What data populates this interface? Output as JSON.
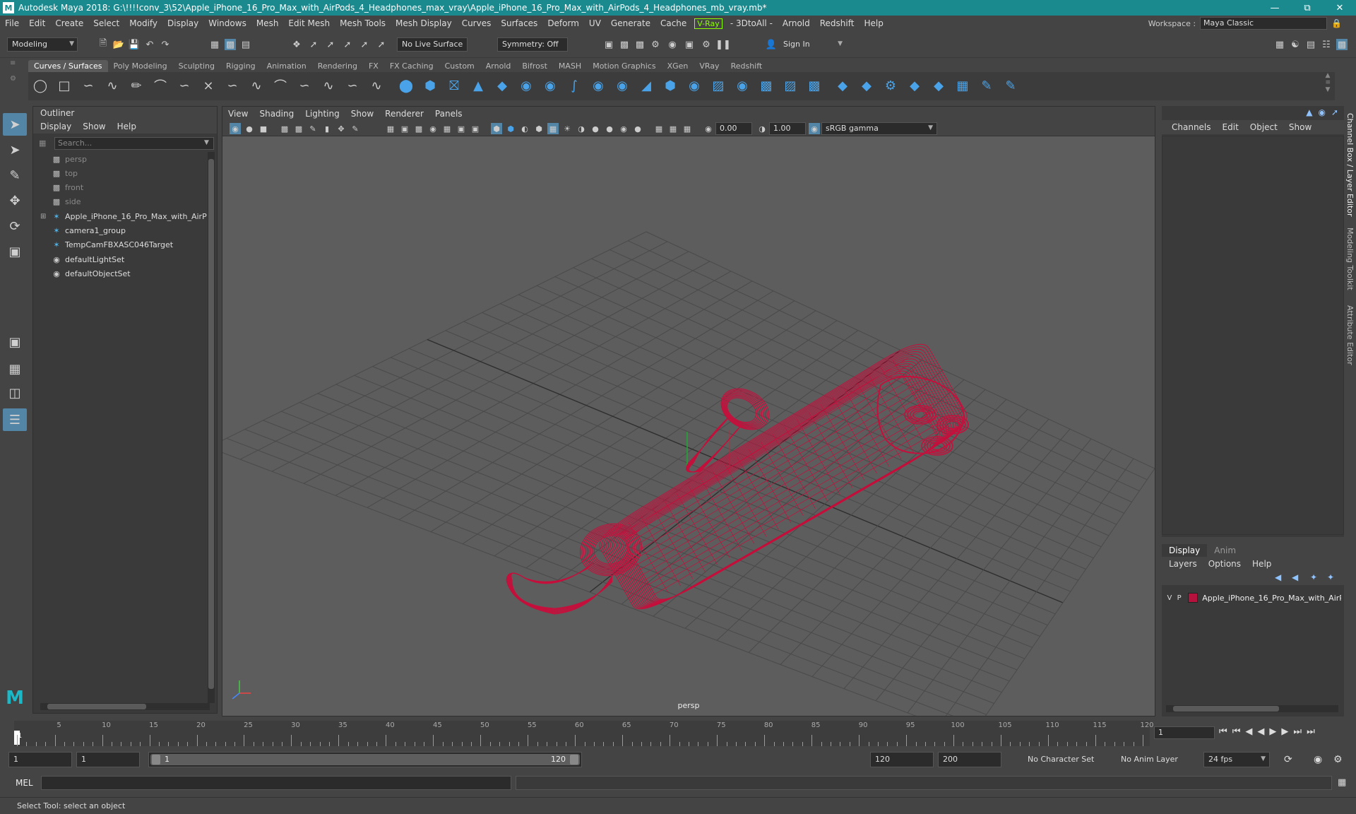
{
  "window": {
    "title": "Autodesk Maya 2018: G:\\!!!!conv_3\\52\\Apple_iPhone_16_Pro_Max_with_AirPods_4_Headphones_max_vray\\Apple_iPhone_16_Pro_Max_with_AirPods_4_Headphones_mb_vray.mb*",
    "logo": "M",
    "controls": [
      "minimize-icon",
      "restore-icon",
      "close-icon"
    ]
  },
  "menubar": {
    "items": [
      "File",
      "Edit",
      "Create",
      "Select",
      "Modify",
      "Display",
      "Windows",
      "Mesh",
      "Edit Mesh",
      "Mesh Tools",
      "Mesh Display",
      "Curves",
      "Surfaces",
      "Deform",
      "UV",
      "Generate",
      "Cache",
      "V-Ray",
      "- 3DtoAll -",
      "Arnold",
      "Redshift",
      "Help"
    ],
    "workspace_label": "Workspace :",
    "workspace_value": "Maya Classic"
  },
  "statusline": {
    "mode": "Modeling",
    "live_surface": "No Live Surface",
    "symmetry": "Symmetry: Off",
    "sign_in": "Sign In"
  },
  "shelf": {
    "tabs": [
      "Curves / Surfaces",
      "Poly Modeling",
      "Sculpting",
      "Rigging",
      "Animation",
      "Rendering",
      "FX",
      "FX Caching",
      "Custom",
      "Arnold",
      "Bifrost",
      "MASH",
      "Motion Graphics",
      "XGen",
      "VRay",
      "Redshift"
    ],
    "active_tab": "Curves / Surfaces"
  },
  "outliner": {
    "title": "Outliner",
    "menus": [
      "Display",
      "Show",
      "Help"
    ],
    "search_placeholder": "Search...",
    "items": [
      {
        "label": "persp",
        "icon": "camera-icon",
        "dim": true
      },
      {
        "label": "top",
        "icon": "camera-icon",
        "dim": true
      },
      {
        "label": "front",
        "icon": "camera-icon",
        "dim": true
      },
      {
        "label": "side",
        "icon": "camera-icon",
        "dim": true
      },
      {
        "label": "Apple_iPhone_16_Pro_Max_with_AirP",
        "icon": "group-icon",
        "dim": false,
        "expandable": true
      },
      {
        "label": "camera1_group",
        "icon": "group-icon",
        "dim": false
      },
      {
        "label": "TempCamFBXASC046Target",
        "icon": "locator-icon",
        "dim": false
      },
      {
        "label": "defaultLightSet",
        "icon": "set-icon",
        "dim": false
      },
      {
        "label": "defaultObjectSet",
        "icon": "set-icon",
        "dim": false
      }
    ]
  },
  "viewport": {
    "menus": [
      "View",
      "Shading",
      "Lighting",
      "Show",
      "Renderer",
      "Panels"
    ],
    "exposure": "0.00",
    "gamma": "1.00",
    "color_space": "sRGB gamma",
    "camera_label": "persp",
    "wire_color": "#c4103c"
  },
  "channelbox": {
    "menus": [
      "Channels",
      "Edit",
      "Object",
      "Show"
    ]
  },
  "sidetabs": [
    "Channel Box / Layer Editor",
    "Modeling Toolkit",
    "Attribute Editor"
  ],
  "layereditor": {
    "tabs": [
      "Display",
      "Anim"
    ],
    "active_tab": "Display",
    "menus": [
      "Layers",
      "Options",
      "Help"
    ],
    "layer": {
      "v": "V",
      "p": "P",
      "name": "Apple_iPhone_16_Pro_Max_with_AirP",
      "color": "#b5123e"
    }
  },
  "timeslider": {
    "start": 1,
    "end": 120,
    "current": 1,
    "current_field": "1",
    "labels": [
      "5",
      "10",
      "15",
      "20",
      "25",
      "30",
      "35",
      "40",
      "45",
      "50",
      "55",
      "60",
      "65",
      "70",
      "75",
      "80",
      "85",
      "90",
      "95",
      "100",
      "105",
      "110",
      "115",
      "120"
    ],
    "first_label": "1"
  },
  "rangeslider": {
    "start_field": "1",
    "playback_start": "1",
    "range_start": "1",
    "range_end": "120",
    "playback_end": "120",
    "end_field": "200",
    "character_set": "No Character Set",
    "anim_layer": "No Anim Layer",
    "fps": "24 fps"
  },
  "cmdline": {
    "label": "MEL"
  },
  "helpline": {
    "text": "Select Tool: select an object"
  }
}
